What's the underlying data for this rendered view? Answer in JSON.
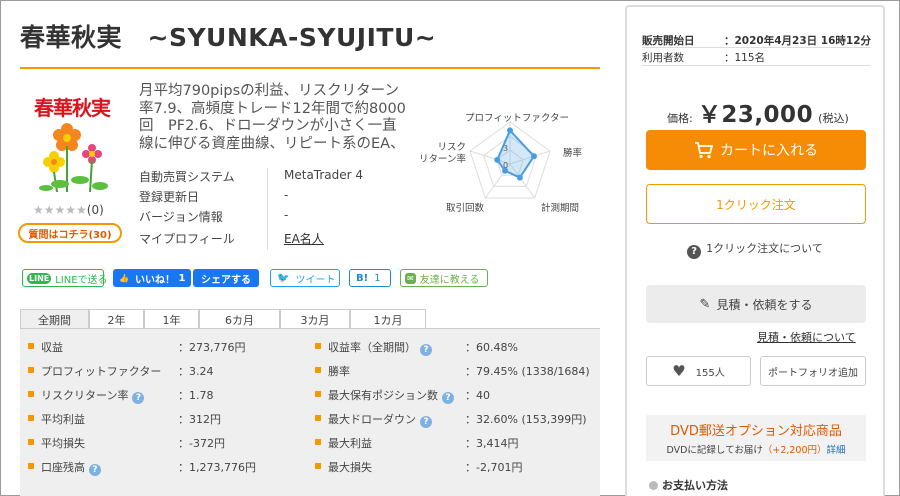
{
  "title": "春華秋実　~SYUNKA-SYUJITU~",
  "logo_text": "春華秋実",
  "rating": {
    "stars": "★★★★★",
    "count": "(0)"
  },
  "question_button": "質問はコチラ(30)",
  "description": "月平均790pipsの利益、リスクリターン率7.9、高頻度トレード12年間で約8000回　PF2.6、ドローダウンが小さく一直線に伸びる資産曲線、リピート系のEA、",
  "info": [
    {
      "label": "自動売買システム",
      "value": "MetaTrader 4"
    },
    {
      "label": "登録更新日",
      "value": "-"
    },
    {
      "label": "バージョン情報",
      "value": "-"
    },
    {
      "label": "マイプロフィール",
      "value": "EA名人"
    }
  ],
  "radar": {
    "labels": [
      "プロフィットファクター",
      "勝率",
      "計測期間",
      "取引回数",
      "リスク",
      "リターン率"
    ],
    "scale_labels": [
      "3",
      "0"
    ],
    "values": [
      4,
      3,
      2,
      1,
      1.6
    ],
    "max": 5
  },
  "social": {
    "line": "LINEで送る",
    "like": "いいね！",
    "like_count": "1",
    "share": "シェアする",
    "tweet": "ツイート",
    "hatena": "B!",
    "hatena_count": "1",
    "friend": "友達に教える"
  },
  "tabs": [
    "全期間",
    "2年",
    "1年",
    "6カ月",
    "3カ月",
    "1カ月"
  ],
  "stats_left": [
    {
      "label": "収益",
      "value": "：273,776円",
      "help": false
    },
    {
      "label": "プロフィットファクター",
      "value": "：3.24",
      "help": false
    },
    {
      "label": "リスクリターン率",
      "value": "：1.78",
      "help": true
    },
    {
      "label": "平均利益",
      "value": "：312円",
      "help": false
    },
    {
      "label": "平均損失",
      "value": "：-372円",
      "help": false
    },
    {
      "label": "口座残高",
      "value": "：1,273,776円",
      "help": true
    }
  ],
  "stats_right": [
    {
      "label": "収益率（全期間）",
      "value": "：60.48%",
      "help": true
    },
    {
      "label": "勝率",
      "value": "：79.45% (1338/1684)",
      "help": false
    },
    {
      "label": "最大保有ポジション数",
      "value": "：40",
      "help": true
    },
    {
      "label": "最大ドローダウン",
      "value": "：32.60% (153,399円)",
      "help": true
    },
    {
      "label": "最大利益",
      "value": "：3,414円",
      "help": false
    },
    {
      "label": "最大損失",
      "value": "：-2,701円",
      "help": false
    }
  ],
  "panel": {
    "sale_start_label": "販売開始日",
    "sale_start_value": "：2020年4月23日 16時12分",
    "users_label": "利用者数",
    "users_value": "：115名",
    "price_label": "価格:",
    "price_value": "￥23,000",
    "price_tax": "(税込)",
    "cart_button": "カートに入れる",
    "oneclick_button": "1クリック注文",
    "oneclick_about": "1クリック注文について",
    "quote_button": "見積・依頼をする",
    "quote_link": "見積・依頼について",
    "favorite_count": "155人",
    "portfolio_button": "ポートフォリオ追加",
    "dvd_title": "DVD郵送オプション対応商品",
    "dvd_sub": "DVDに記録してお届け",
    "dvd_fee": "（+2,200円）",
    "dvd_detail": "詳細",
    "payment_title": "お支払い方法"
  },
  "colors": {
    "accent": "#f39800",
    "cart": "#f68b06",
    "facebook": "#1877f2",
    "line": "#2fb84b",
    "twitter": "#1da1f2",
    "radar": "#4a9ee0"
  }
}
